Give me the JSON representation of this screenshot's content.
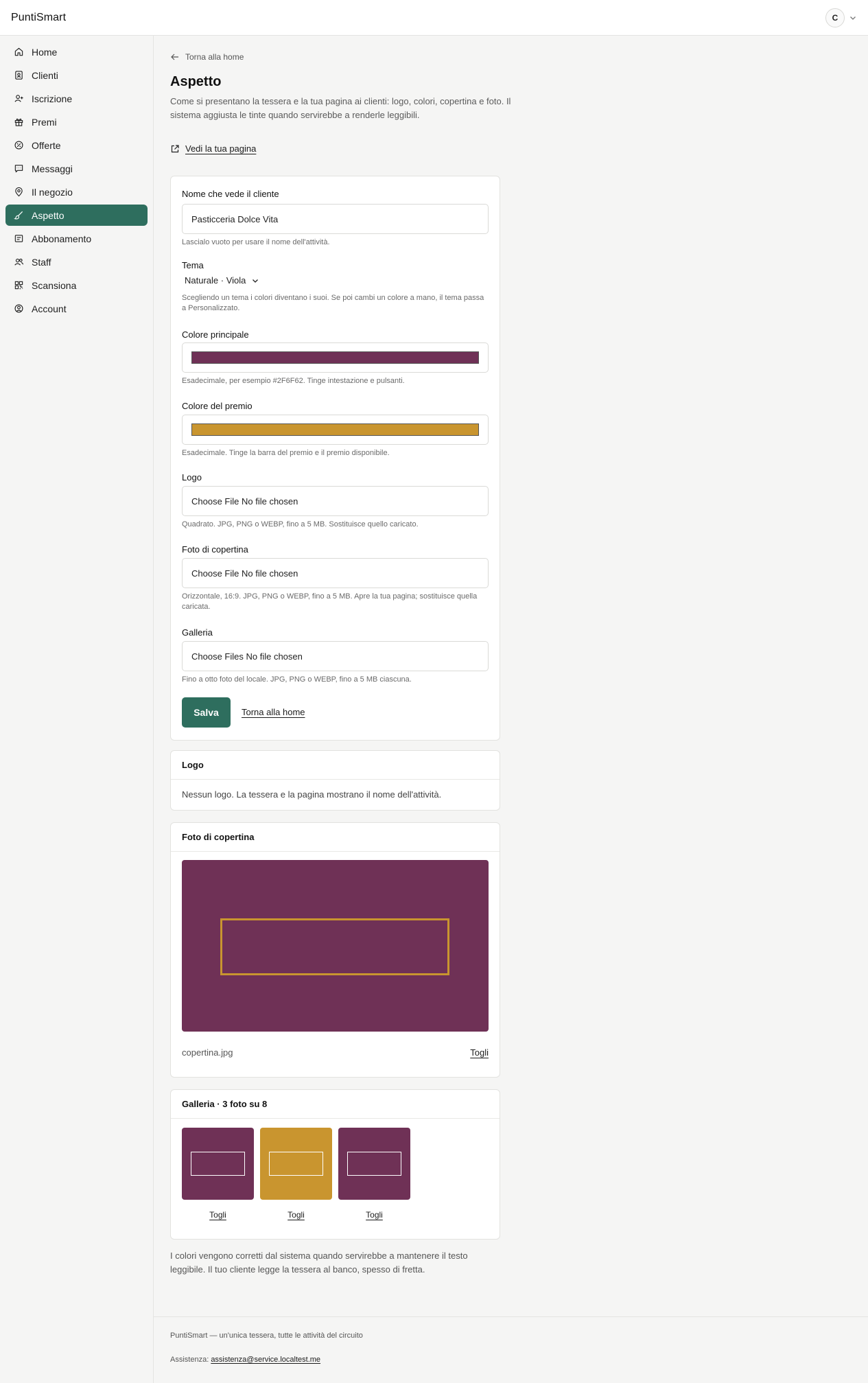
{
  "app": {
    "brand": "PuntiSmart",
    "avatar_initial": "C"
  },
  "sidebar": {
    "items": [
      {
        "label": "Home",
        "icon": "house-icon"
      },
      {
        "label": "Clienti",
        "icon": "contacts-icon"
      },
      {
        "label": "Iscrizione",
        "icon": "user-plus-icon"
      },
      {
        "label": "Premi",
        "icon": "gift-icon"
      },
      {
        "label": "Offerte",
        "icon": "badge-percent-icon"
      },
      {
        "label": "Messaggi",
        "icon": "message-icon"
      },
      {
        "label": "Il negozio",
        "icon": "map-pin-icon"
      },
      {
        "label": "Aspetto",
        "icon": "brush-icon",
        "active": true
      },
      {
        "label": "Abbonamento",
        "icon": "receipt-icon"
      },
      {
        "label": "Staff",
        "icon": "users-icon"
      },
      {
        "label": "Scansiona",
        "icon": "qr-icon"
      },
      {
        "label": "Account",
        "icon": "user-circle-icon"
      }
    ]
  },
  "page": {
    "back_label": "Torna alla home",
    "title": "Aspetto",
    "description": "Come si presentano la tessera e la tua pagina ai clienti: logo, colori, copertina e foto. Il sistema aggiusta le tinte quando servirebbe a renderle leggibili.",
    "view_page_label": "Vedi la tua pagina"
  },
  "form": {
    "display_name": {
      "label": "Nome che vede il cliente",
      "value": "Pasticceria Dolce Vita",
      "help": "Lascialo vuoto per usare il nome dell'attività."
    },
    "theme": {
      "label": "Tema",
      "value": "Naturale · Viola",
      "help": "Scegliendo un tema i colori diventano i suoi. Se poi cambi un colore a mano, il tema passa a Personalizzato."
    },
    "primary_color": {
      "label": "Colore principale",
      "color": "#6f3156",
      "help": "Esadecimale, per esempio #2F6F62. Tinge intestazione e pulsanti."
    },
    "reward_color": {
      "label": "Colore del premio",
      "color": "#c9952f",
      "help": "Esadecimale. Tinge la barra del premio e il premio disponibile."
    },
    "logo": {
      "label": "Logo",
      "value": "Choose File No file chosen",
      "help": "Quadrato. JPG, PNG o WEBP, fino a 5 MB. Sostituisce quello caricato."
    },
    "cover": {
      "label": "Foto di copertina",
      "value": "Choose File No file chosen",
      "help": "Orizzontale, 16:9. JPG, PNG o WEBP, fino a 5 MB. Apre la tua pagina; sostituisce quella caricata."
    },
    "gallery": {
      "label": "Galleria",
      "value": "Choose Files No file chosen",
      "help": "Fino a otto foto del locale. JPG, PNG o WEBP, fino a 5 MB ciascuna."
    },
    "save_label": "Salva",
    "back_label": "Torna alla home"
  },
  "logo_card": {
    "title": "Logo",
    "empty_text": "Nessun logo. La tessera e la pagina mostrano il nome dell'attività."
  },
  "cover_card": {
    "title": "Foto di copertina",
    "file_name": "copertina.jpg",
    "remove_label": "Togli",
    "background": "#6f3156",
    "frame_color": "#c9952f"
  },
  "gallery_card": {
    "title": "Galleria · 3 foto su 8",
    "photos": [
      {
        "color": "#6f3156",
        "remove_label": "Togli"
      },
      {
        "color": "#c9952f",
        "remove_label": "Togli"
      },
      {
        "color": "#6f3156",
        "remove_label": "Togli"
      }
    ]
  },
  "footnote": "I colori vengono corretti dal sistema quando servirebbe a mantenere il testo leggibile. Il tuo cliente legge la tessera al banco, spesso di fretta.",
  "footer": {
    "tagline": "PuntiSmart — un'unica tessera, tutte le attività del circuito",
    "support_label": "Assistenza:",
    "support_email": "assistenza@service.localtest.me"
  },
  "colors": {
    "accent": "#2e6e5e"
  }
}
